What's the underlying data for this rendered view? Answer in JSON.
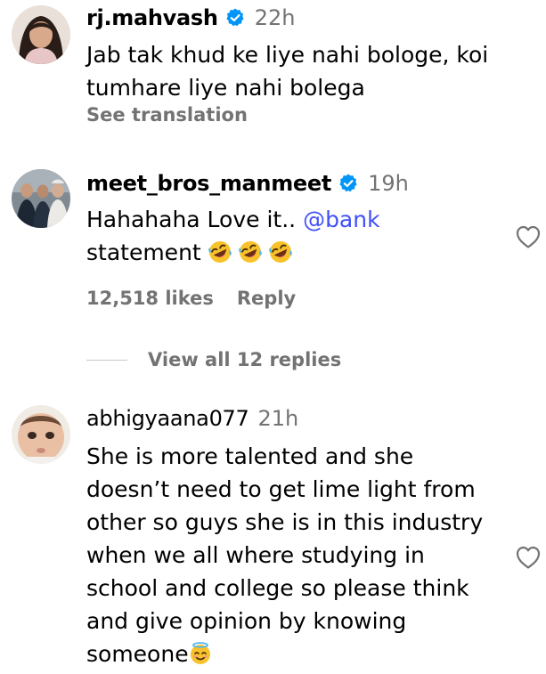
{
  "colors": {
    "mention": "#4150f7",
    "secondary_text": "#737373",
    "verified_badge": "#0095f6"
  },
  "comments": [
    {
      "username": "rj.mahvash",
      "verified": true,
      "time": "22h",
      "lines": [
        "Jab tak khud ke liye nahi bologe, koi",
        "tumhare liye nahi bolega"
      ],
      "see_translation": "See translation",
      "avatar_icon": "avatar-photo"
    },
    {
      "username": "meet_bros_manmeet",
      "verified": true,
      "time": "19h",
      "line1_text": "Hahahaha Love it.. ",
      "mention": "@bank",
      "line2_text": "statement ",
      "emoji_icon": "rolling-on-floor-laughing-emoji",
      "likes": "12,518 likes",
      "reply": "Reply",
      "view_replies": "View all 12 replies",
      "heart_icon": "heart-outline-icon"
    },
    {
      "username": "abhigyaana077",
      "verified": false,
      "time": "21h",
      "lines": [
        "She is more talented and she",
        "doesn’t need to get lime light from",
        "other so guys she is in this industry",
        "when we all where studying in",
        "school and college so please think",
        "and give opinion by knowing"
      ],
      "last_line": "someone",
      "emoji_icon": "smiling-face-with-halo-emoji",
      "heart_icon": "heart-outline-icon"
    }
  ]
}
